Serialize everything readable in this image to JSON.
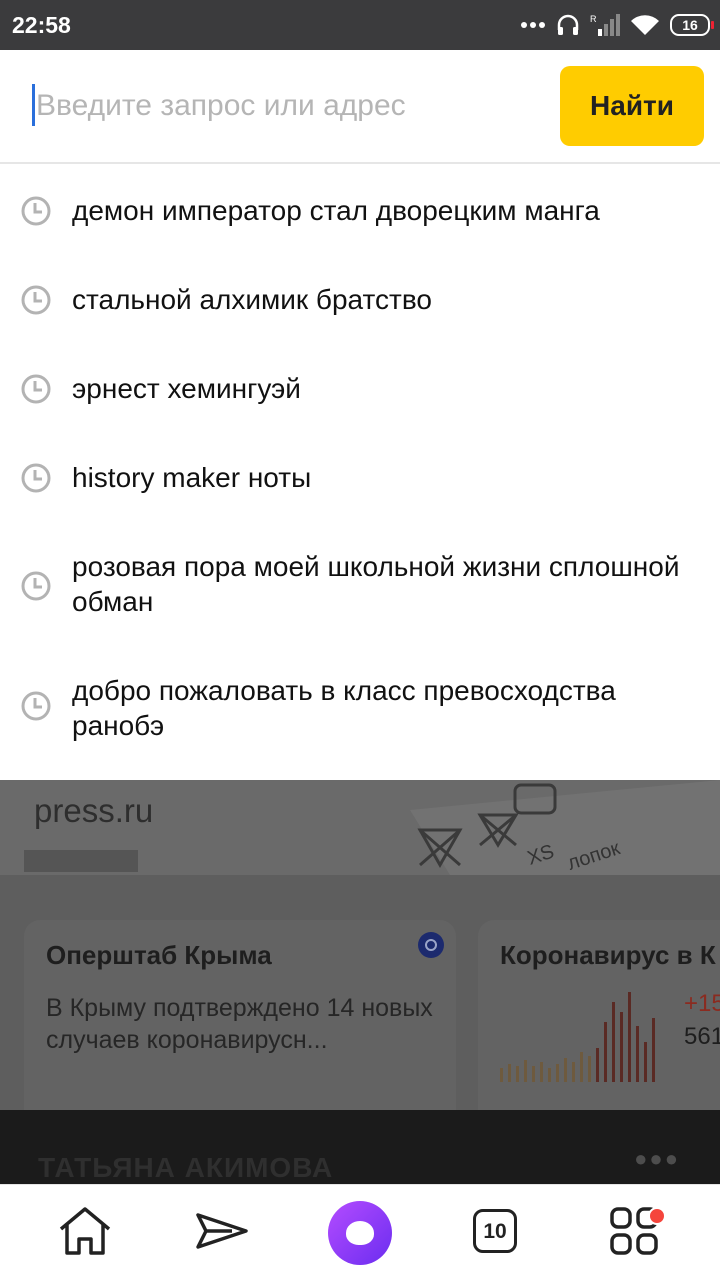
{
  "status_bar": {
    "time": "22:58",
    "battery": "16"
  },
  "search": {
    "placeholder": "Введите запрос или адрес",
    "value": "",
    "button_label": "Найти"
  },
  "suggestions": [
    {
      "text": "демон император стал дворецким манга"
    },
    {
      "text": "стальной алхимик братство"
    },
    {
      "text": "эрнест хемингуэй"
    },
    {
      "text": "history maker ноты"
    },
    {
      "text": "розовая пора моей школьной жизни сплошной обман"
    },
    {
      "text": "добро пожаловать в класс превосходства ранобэ"
    }
  ],
  "background": {
    "banner_source": "press.ru",
    "card1": {
      "title": "Оперштаб Крыма",
      "text": "В Крыму подтверждено 14 новых случаев коронавирусн..."
    },
    "card2": {
      "title": "Коронавирус в К",
      "stat_delta": "+15",
      "stat_total": "561"
    },
    "next_title": "ТАТЬЯНА АКИМОВА"
  },
  "bottom_nav": {
    "tabs_count": "10"
  }
}
